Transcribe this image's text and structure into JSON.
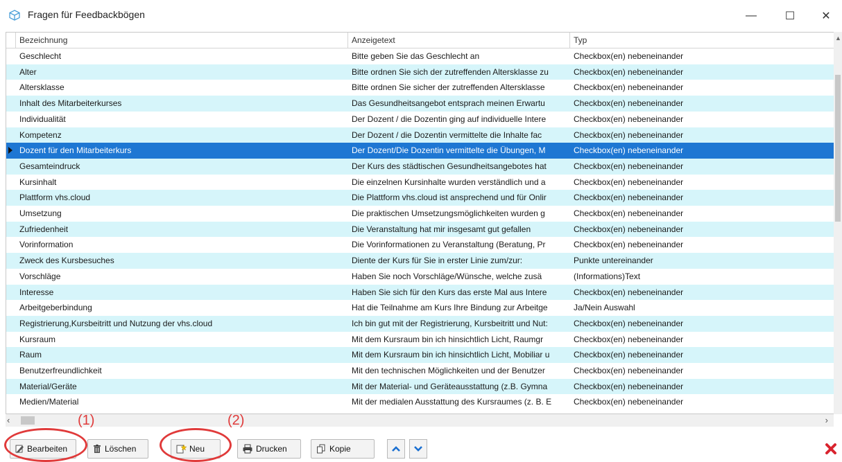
{
  "window": {
    "title": "Fragen für Feedbackbögen",
    "controls": {
      "minimize": "—",
      "maximize": "☐",
      "close": "✕"
    }
  },
  "grid": {
    "columns": [
      "Bezeichnung",
      "Anzeigetext",
      "Typ"
    ],
    "selected_row": 6,
    "rows": [
      [
        "Geschlecht",
        "Bitte geben Sie das Geschlecht an",
        "Checkbox(en) nebeneinander"
      ],
      [
        "Alter",
        "Bitte ordnen Sie sich der zutreffenden Altersklasse zu",
        "Checkbox(en) nebeneinander"
      ],
      [
        "Altersklasse",
        "Bitte ordnen Sie sicher der zutreffenden Altersklasse",
        "Checkbox(en) nebeneinander"
      ],
      [
        "Inhalt des Mitarbeiterkurses",
        "Das Gesundheitsangebot entsprach meinen Erwartu",
        "Checkbox(en) nebeneinander"
      ],
      [
        "Individualität",
        "Der Dozent / die Dozentin ging auf individuelle Intere",
        "Checkbox(en) nebeneinander"
      ],
      [
        "Kompetenz",
        "Der Dozent / die Dozentin vermittelte die Inhalte fac",
        "Checkbox(en) nebeneinander"
      ],
      [
        "Dozent für den Mitarbeiterkurs",
        "Der Dozent/Die Dozentin vermittelte die Übungen, M",
        "Checkbox(en) nebeneinander"
      ],
      [
        "Gesamteindruck",
        "Der Kurs des städtischen Gesundheitsangebotes hat",
        "Checkbox(en) nebeneinander"
      ],
      [
        "Kursinhalt",
        "Die einzelnen Kursinhalte wurden verständlich und a",
        "Checkbox(en) nebeneinander"
      ],
      [
        "Plattform vhs.cloud",
        "Die Plattform vhs.cloud ist ansprechend und für Onlir",
        "Checkbox(en) nebeneinander"
      ],
      [
        "Umsetzung",
        "Die praktischen Umsetzungsmöglichkeiten wurden g",
        "Checkbox(en) nebeneinander"
      ],
      [
        "Zufriedenheit",
        "Die Veranstaltung hat mir insgesamt gut gefallen",
        "Checkbox(en) nebeneinander"
      ],
      [
        "Vorinformation",
        "Die Vorinformationen zu Veranstaltung (Beratung, Pr",
        "Checkbox(en) nebeneinander"
      ],
      [
        "Zweck des Kursbesuches",
        "Diente der Kurs für Sie in erster Linie zum/zur:",
        "Punkte untereinander"
      ],
      [
        "Vorschläge",
        "Haben Sie noch Vorschläge/Wünsche, welche zusä",
        "(Informations)Text"
      ],
      [
        "Interesse",
        "Haben Sie sich für den Kurs das erste Mal aus Intere",
        "Checkbox(en) nebeneinander"
      ],
      [
        "Arbeitgeberbindung",
        "Hat die Teilnahme am Kurs Ihre Bindung zur Arbeitge",
        "Ja/Nein Auswahl"
      ],
      [
        "Registrierung,Kursbeitritt und Nutzung der vhs.cloud",
        "Ich bin gut mit der Registrierung, Kursbeitritt und Nut:",
        "Checkbox(en) nebeneinander"
      ],
      [
        "Kursraum",
        "Mit dem Kursraum bin ich hinsichtlich Licht, Raumgr",
        "Checkbox(en) nebeneinander"
      ],
      [
        "Raum",
        "Mit dem Kursraum bin ich hinsichtlich Licht, Mobiliar u",
        "Checkbox(en) nebeneinander"
      ],
      [
        "Benutzerfreundlichkeit",
        "Mit den technischen Möglichkeiten und der Benutzer",
        "Checkbox(en) nebeneinander"
      ],
      [
        "Material/Geräte",
        "Mit der Material- und Geräteausstattung (z.B. Gymna",
        "Checkbox(en) nebeneinander"
      ],
      [
        "Medien/Material",
        "Mit der medialen Ausstattung des Kursraumes (z. B. E",
        "Checkbox(en) nebeneinander"
      ]
    ]
  },
  "toolbar": {
    "edit_label": "Bearbeiten",
    "delete_label": "Löschen",
    "new_label": "Neu",
    "print_label": "Drucken",
    "copy_label": "Kopie"
  },
  "annotations": {
    "first": "(1)",
    "second": "(2)"
  },
  "colors": {
    "selection": "#1e77d3",
    "alt_row": "#d6f5fa",
    "annotation": "#e03a3a",
    "close_red": "#d9232e"
  }
}
